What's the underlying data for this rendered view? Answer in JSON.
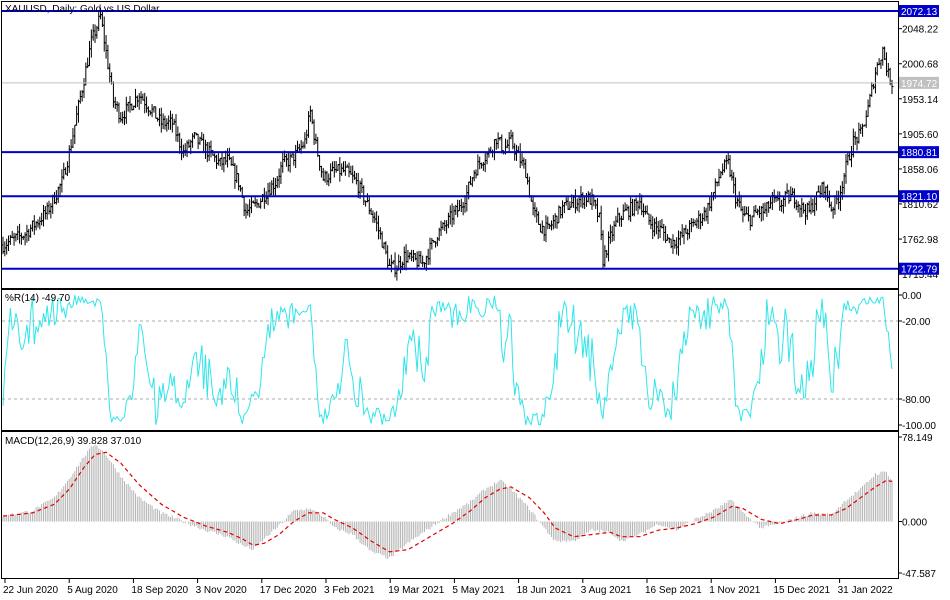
{
  "chart_data": [
    {
      "type": "candlestick",
      "title": "XAUUSD, Daily:  Gold vs US Dollar",
      "ylim": [
        1698,
        2083
      ],
      "y_ticks": [
        "2048.22",
        "2000.68",
        "1953.14",
        "1905.60",
        "1858.06",
        "1810.62",
        "1762.98",
        "1715.44"
      ],
      "current_price": "1974.72",
      "levels": [
        {
          "label": "2072.13",
          "value": 2072.13
        },
        {
          "label": "1880.81",
          "value": 1880.81
        },
        {
          "label": "1821.10",
          "value": 1821.1
        },
        {
          "label": "1722.79",
          "value": 1722.79
        }
      ],
      "x_dates": [
        "22 Jun 2020",
        "5 Aug 2020",
        "18 Sep 2020",
        "3 Nov 2020",
        "17 Dec 2020",
        "3 Feb 2021",
        "19 Mar 2021",
        "5 May 2021",
        "18 Jun 2021",
        "3 Aug 2021",
        "16 Sep 2021",
        "1 Nov 2021",
        "15 Dec 2021",
        "31 Jan 2022"
      ],
      "price_path": [
        [
          0,
          1755
        ],
        [
          12,
          1770
        ],
        [
          24,
          1800
        ],
        [
          32,
          1840
        ],
        [
          36,
          1880
        ],
        [
          40,
          1930
        ],
        [
          44,
          1980
        ],
        [
          48,
          2030
        ],
        [
          53,
          2065
        ],
        [
          57,
          2000
        ],
        [
          60,
          1950
        ],
        [
          64,
          1930
        ],
        [
          68,
          1940
        ],
        [
          74,
          1960
        ],
        [
          80,
          1940
        ],
        [
          86,
          1920
        ],
        [
          92,
          1920
        ],
        [
          98,
          1880
        ],
        [
          104,
          1900
        ],
        [
          108,
          1890
        ],
        [
          112,
          1880
        ],
        [
          118,
          1865
        ],
        [
          122,
          1870
        ],
        [
          128,
          1840
        ],
        [
          132,
          1800
        ],
        [
          138,
          1810
        ],
        [
          144,
          1830
        ],
        [
          148,
          1840
        ],
        [
          152,
          1865
        ],
        [
          156,
          1870
        ],
        [
          160,
          1880
        ],
        [
          164,
          1895
        ],
        [
          167,
          1935
        ],
        [
          170,
          1890
        ],
        [
          174,
          1845
        ],
        [
          180,
          1855
        ],
        [
          186,
          1855
        ],
        [
          192,
          1840
        ],
        [
          198,
          1810
        ],
        [
          202,
          1790
        ],
        [
          206,
          1760
        ],
        [
          210,
          1725
        ],
        [
          214,
          1725
        ],
        [
          218,
          1740
        ],
        [
          222,
          1735
        ],
        [
          228,
          1730
        ],
        [
          232,
          1750
        ],
        [
          236,
          1770
        ],
        [
          240,
          1780
        ],
        [
          244,
          1795
        ],
        [
          248,
          1805
        ],
        [
          252,
          1825
        ],
        [
          256,
          1855
        ],
        [
          260,
          1870
        ],
        [
          264,
          1880
        ],
        [
          268,
          1900
        ],
        [
          272,
          1885
        ],
        [
          276,
          1895
        ],
        [
          280,
          1875
        ],
        [
          284,
          1855
        ],
        [
          288,
          1800
        ],
        [
          292,
          1780
        ],
        [
          296,
          1775
        ],
        [
          300,
          1790
        ],
        [
          304,
          1805
        ],
        [
          308,
          1810
        ],
        [
          312,
          1815
        ],
        [
          316,
          1820
        ],
        [
          320,
          1815
        ],
        [
          324,
          1790
        ],
        [
          326,
          1735
        ],
        [
          330,
          1765
        ],
        [
          334,
          1790
        ],
        [
          338,
          1800
        ],
        [
          342,
          1805
        ],
        [
          346,
          1815
        ],
        [
          350,
          1790
        ],
        [
          354,
          1780
        ],
        [
          358,
          1775
        ],
        [
          362,
          1760
        ],
        [
          366,
          1760
        ],
        [
          370,
          1770
        ],
        [
          374,
          1780
        ],
        [
          378,
          1790
        ],
        [
          382,
          1800
        ],
        [
          386,
          1825
        ],
        [
          390,
          1855
        ],
        [
          394,
          1865
        ],
        [
          398,
          1820
        ],
        [
          402,
          1795
        ],
        [
          406,
          1790
        ],
        [
          410,
          1800
        ],
        [
          414,
          1800
        ],
        [
          418,
          1815
        ],
        [
          422,
          1810
        ],
        [
          426,
          1820
        ],
        [
          430,
          1820
        ],
        [
          434,
          1805
        ],
        [
          438,
          1800
        ],
        [
          442,
          1820
        ],
        [
          446,
          1835
        ],
        [
          450,
          1805
        ],
        [
          454,
          1820
        ],
        [
          458,
          1860
        ],
        [
          462,
          1895
        ],
        [
          466,
          1905
        ],
        [
          470,
          1940
        ],
        [
          474,
          1990
        ],
        [
          478,
          2020
        ],
        [
          481,
          1985
        ],
        [
          483,
          1975
        ]
      ]
    },
    {
      "type": "line",
      "title": "%R(14) -49.70",
      "ylim": [
        -100,
        0
      ],
      "y_ticks": [
        "0.00",
        "-20.00",
        "-80.00",
        "-100.00"
      ],
      "levels": [
        -20,
        -80
      ]
    },
    {
      "type": "bar+line",
      "title": "MACD(12,26,9) 39.828 37.010",
      "ylim": [
        -47.587,
        78.149
      ],
      "y_ticks": [
        "78.149",
        "0.000",
        "-47.587"
      ],
      "macd_path": [
        [
          0,
          5
        ],
        [
          16,
          10
        ],
        [
          28,
          22
        ],
        [
          36,
          40
        ],
        [
          44,
          60
        ],
        [
          50,
          72
        ],
        [
          56,
          62
        ],
        [
          64,
          42
        ],
        [
          74,
          22
        ],
        [
          86,
          8
        ],
        [
          98,
          0
        ],
        [
          110,
          -8
        ],
        [
          122,
          -14
        ],
        [
          130,
          -22
        ],
        [
          136,
          -26
        ],
        [
          142,
          -16
        ],
        [
          150,
          -4
        ],
        [
          158,
          10
        ],
        [
          166,
          12
        ],
        [
          174,
          5
        ],
        [
          180,
          -6
        ],
        [
          190,
          -12
        ],
        [
          200,
          -28
        ],
        [
          210,
          -34
        ],
        [
          220,
          -20
        ],
        [
          232,
          -6
        ],
        [
          244,
          8
        ],
        [
          254,
          18
        ],
        [
          262,
          30
        ],
        [
          270,
          38
        ],
        [
          276,
          30
        ],
        [
          286,
          12
        ],
        [
          294,
          -6
        ],
        [
          300,
          -18
        ],
        [
          310,
          -18
        ],
        [
          320,
          -8
        ],
        [
          330,
          -10
        ],
        [
          336,
          -18
        ],
        [
          346,
          -12
        ],
        [
          356,
          -2
        ],
        [
          366,
          -8
        ],
        [
          376,
          2
        ],
        [
          386,
          10
        ],
        [
          396,
          20
        ],
        [
          402,
          8
        ],
        [
          412,
          -6
        ],
        [
          422,
          -2
        ],
        [
          432,
          4
        ],
        [
          440,
          8
        ],
        [
          450,
          6
        ],
        [
          458,
          20
        ],
        [
          466,
          30
        ],
        [
          474,
          44
        ],
        [
          480,
          46
        ],
        [
          483,
          38
        ]
      ],
      "signal_path": [
        [
          0,
          5
        ],
        [
          16,
          8
        ],
        [
          28,
          16
        ],
        [
          36,
          30
        ],
        [
          44,
          50
        ],
        [
          50,
          62
        ],
        [
          56,
          64
        ],
        [
          64,
          54
        ],
        [
          74,
          34
        ],
        [
          86,
          16
        ],
        [
          98,
          4
        ],
        [
          110,
          -4
        ],
        [
          122,
          -10
        ],
        [
          130,
          -16
        ],
        [
          136,
          -22
        ],
        [
          142,
          -20
        ],
        [
          150,
          -12
        ],
        [
          158,
          0
        ],
        [
          166,
          8
        ],
        [
          174,
          8
        ],
        [
          180,
          2
        ],
        [
          190,
          -6
        ],
        [
          200,
          -18
        ],
        [
          210,
          -28
        ],
        [
          220,
          -26
        ],
        [
          232,
          -14
        ],
        [
          244,
          -2
        ],
        [
          254,
          10
        ],
        [
          262,
          22
        ],
        [
          270,
          30
        ],
        [
          276,
          32
        ],
        [
          286,
          22
        ],
        [
          294,
          8
        ],
        [
          300,
          -6
        ],
        [
          310,
          -14
        ],
        [
          320,
          -12
        ],
        [
          330,
          -10
        ],
        [
          336,
          -14
        ],
        [
          346,
          -14
        ],
        [
          356,
          -8
        ],
        [
          366,
          -6
        ],
        [
          376,
          -2
        ],
        [
          386,
          4
        ],
        [
          396,
          14
        ],
        [
          402,
          12
        ],
        [
          412,
          2
        ],
        [
          422,
          -2
        ],
        [
          432,
          2
        ],
        [
          440,
          6
        ],
        [
          450,
          6
        ],
        [
          458,
          12
        ],
        [
          466,
          22
        ],
        [
          474,
          32
        ],
        [
          480,
          38
        ],
        [
          483,
          37
        ]
      ]
    }
  ]
}
